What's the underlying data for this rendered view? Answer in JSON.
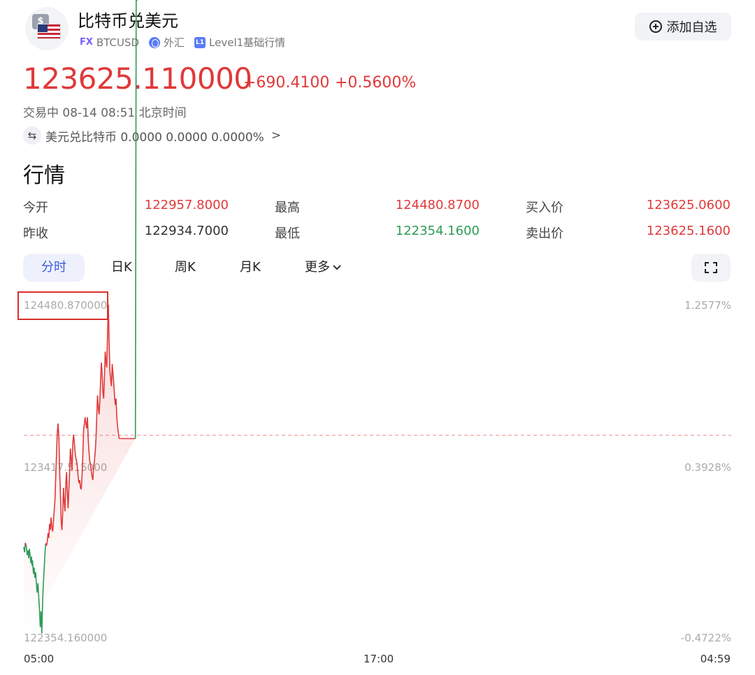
{
  "header": {
    "title": "比特币兑美元",
    "tag_fx": "FX",
    "symbol": "BTCUSD",
    "market": "外汇",
    "level_badge": "L1",
    "level": "Level1基础行情",
    "add_watchlist": "添加自选"
  },
  "quote": {
    "price": "123625.110000",
    "change": "+690.4100",
    "change_pct": "+0.5600%",
    "status": "交易中 08-14 08:51 北京时间",
    "reverse_pair": "美元兑比特币 0.0000 0.0000 0.0000%",
    "reverse_chevron": ">",
    "swap_icon_glyph": "⇆",
    "color_up": "#e0393a",
    "color_down": "#2e9a56"
  },
  "market_section": {
    "title": "行情",
    "rows": [
      [
        {
          "label": "今开",
          "value": "122957.8000",
          "color": "red"
        },
        {
          "label": "最高",
          "value": "124480.8700",
          "color": "red"
        },
        {
          "label": "买入价",
          "value": "123625.0600",
          "color": "red"
        }
      ],
      [
        {
          "label": "昨收",
          "value": "122934.7000",
          "color": "dark"
        },
        {
          "label": "最低",
          "value": "122354.1600",
          "color": "green"
        },
        {
          "label": "卖出价",
          "value": "123625.1600",
          "color": "red"
        }
      ]
    ]
  },
  "tabs": {
    "items": [
      "分时",
      "日K",
      "周K",
      "月K",
      "更多"
    ],
    "active": "分时",
    "more_icon": "chevron-down-icon",
    "fullscreen_icon": "fullscreen-icon"
  },
  "chart": {
    "y_left": [
      "124480.870000",
      "123417.515000",
      "122354.160000"
    ],
    "y_right": [
      "1.2577%",
      "0.3928%",
      "-0.4722%"
    ],
    "x_labels": [
      "05:00",
      "17:00",
      "04:59"
    ],
    "prev_close": 122934.7
  },
  "chart_data": {
    "type": "line",
    "title": "",
    "xlabel": "",
    "ylabel": "",
    "ylim": [
      122354.16,
      124480.87
    ],
    "x_ticks": [
      "05:00",
      "17:00",
      "04:59"
    ],
    "reference_line": 122934.7,
    "x": [
      0,
      0.3,
      0.6,
      1,
      1.3,
      1.6,
      1.9,
      2.2,
      2.5,
      2.8,
      3,
      3.2,
      3.4,
      3.6,
      3.8,
      4,
      4.3,
      4.6,
      4.9,
      5.2,
      5.5,
      5.8,
      6.1,
      6.4,
      6.7,
      7,
      7.3,
      7.6,
      7.9,
      8.2,
      8.5,
      8.8,
      9.1,
      9.4,
      9.7,
      10,
      10.3,
      10.6,
      10.9,
      11.2,
      11.5,
      11.8,
      12.1,
      12.4,
      12.7,
      13,
      13.3,
      13.6,
      13.9,
      14.2,
      14.5,
      14.8,
      15.1,
      15.4,
      15.7,
      16,
      16.3,
      16.6,
      16.9,
      17.2,
      17.5,
      17.8,
      18.1,
      18.4,
      18.7,
      19,
      19.3,
      19.6,
      19.9,
      20.2,
      20.5,
      20.8,
      21.1,
      21.4,
      21.7,
      22,
      22.3,
      22.6,
      22.9,
      23.2,
      23.5,
      23.8,
      24.1,
      24.4,
      24.7,
      25,
      25.3,
      25.6,
      25.9,
      26.2,
      26.5,
      26.8,
      27.1,
      27.4,
      27.7,
      28,
      28.3,
      28.6,
      28.9,
      29.2,
      29.5,
      29.8,
      30.1,
      30.4,
      30.7,
      31,
      31.3,
      31.6,
      31.9,
      32.2,
      32.5,
      32.8,
      33.1,
      33.4,
      33.7,
      34,
      34.3,
      34.6,
      34.9,
      35.2,
      35.5,
      35.8,
      36.1,
      36.4,
      36.7,
      37,
      37.3,
      37.6,
      37.9,
      38.2,
      38.5,
      38.8,
      39.1,
      39.4,
      39.7,
      40,
      40.3,
      40.6,
      40.9,
      41.2,
      41.5,
      41.8,
      42.1,
      42.4,
      42.7,
      43,
      43.3,
      43.6,
      43.9,
      44.2
    ],
    "series": [
      {
        "values": [
          122932,
          122898,
          122958,
          122935,
          122880,
          122910,
          122860,
          122920,
          122870,
          122828,
          122870,
          122812,
          122845,
          122790,
          122760,
          122800,
          122735,
          122770,
          122690,
          122640,
          122700,
          122610,
          122530,
          122420,
          122520,
          122380,
          122570,
          122700,
          122780,
          122880,
          122955,
          122940,
          122965,
          123020,
          122990,
          123080,
          123040,
          123120,
          123055,
          123030,
          123090,
          123160,
          123230,
          123380,
          123520,
          123660,
          123720,
          123640,
          123420,
          123280,
          123100,
          123040,
          123150,
          123310,
          123220,
          123160,
          123330,
          123410,
          123290,
          123180,
          123300,
          123410,
          123560,
          123490,
          123420,
          123590,
          123650,
          123600,
          123540,
          123500,
          123480,
          123440,
          123380,
          123340,
          123360,
          123310,
          123300,
          123380,
          123520,
          123680,
          123720,
          123760,
          123720,
          123690,
          123760,
          123620,
          123540,
          123480,
          123460,
          123420,
          123380,
          123360,
          123440,
          123480,
          123540,
          123620,
          123760,
          123900,
          123830,
          123780,
          123860,
          124000,
          124110,
          124040,
          123920,
          123880,
          124020,
          124180,
          124120,
          124080,
          124300,
          124480,
          124240,
          124060,
          124000,
          123960,
          124100,
          124040,
          123980,
          123900,
          123840,
          123880,
          123760,
          123700,
          123660,
          123625,
          123625,
          123625,
          123625,
          123625,
          123625,
          123625,
          123625,
          123625,
          123625,
          123625,
          123625,
          123625,
          123625,
          123625,
          123625,
          123625,
          123625,
          123625,
          123625,
          123625,
          123625
        ]
      }
    ]
  }
}
